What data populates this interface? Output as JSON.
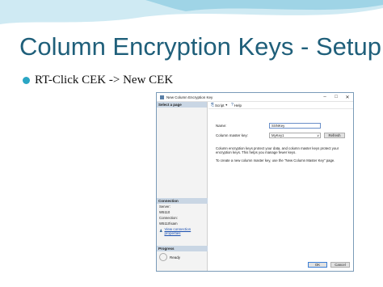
{
  "slide": {
    "title": "Column Encryption Keys - Setup",
    "bullet": "RT-Click CEK -> New CEK"
  },
  "dialog": {
    "title": "New Column Encryption Key",
    "left": {
      "select_page": "Select a page",
      "connection_header": "Connection",
      "server_label": "Server:",
      "server_value": "W5110",
      "connection_label": "Connection:",
      "connection_value": "W5110\\sam",
      "view_props_link": "View connection properties",
      "progress_header": "Progress",
      "progress_status": "Ready"
    },
    "toolbar": {
      "script_label": "Script",
      "help_label": "Help"
    },
    "form": {
      "name_label": "Name:",
      "name_value": "SSNKey",
      "cmk_label": "Column master key:",
      "cmk_value": "MyKey1",
      "refresh_label": "Refresh"
    },
    "description_1": "Column encryption keys protect your data, and column master keys protect your encryption keys. This helps you manage fewer keys.",
    "description_2": "To create a new column master key, use the \"New Column Master Key\" page.",
    "ok_label": "OK",
    "cancel_label": "Cancel"
  },
  "colors": {
    "title": "#1f5f7a",
    "bullet": "#2aa6c4",
    "pane_header": "#c9d6e4"
  }
}
